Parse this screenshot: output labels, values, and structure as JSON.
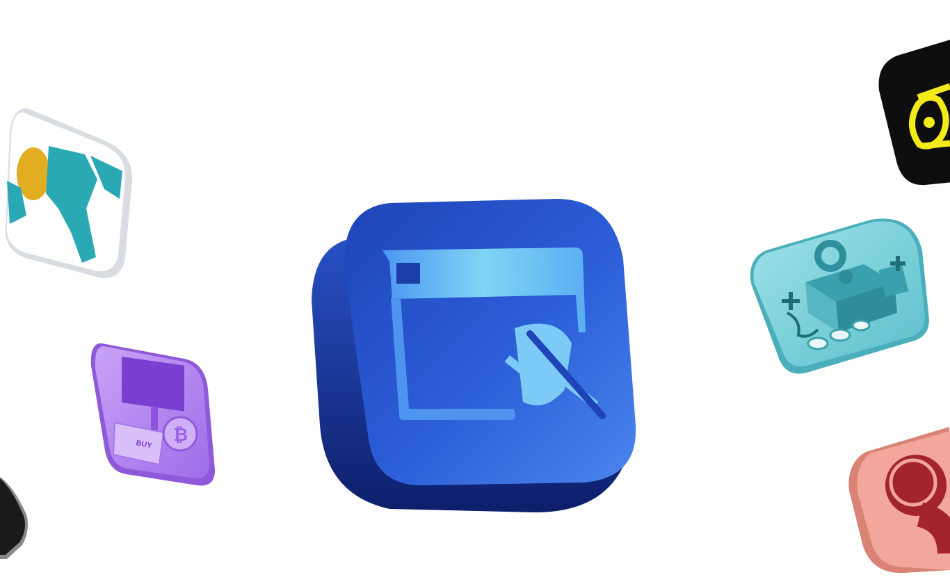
{
  "scene": {
    "background": "#ffffff",
    "tiles": [
      {
        "name": "web-plugin-disconnect",
        "icon": "browser-window-unplugged-icon",
        "color": "#2f5fd8"
      },
      {
        "name": "world-map",
        "icon": "globe-map-icon",
        "color": "#2aa8b3"
      },
      {
        "name": "crypto-buy",
        "icon": "bitcoin-terminal-icon",
        "color": "#b888f0"
      },
      {
        "name": "crypto-network",
        "icon": "blockchain-puzzle-icon",
        "color": "#6fc9d3"
      },
      {
        "name": "announcement",
        "icon": "megaphone-icon",
        "color": "#111111"
      },
      {
        "name": "record",
        "icon": "record-button-icon",
        "color": "#f1a294"
      },
      {
        "name": "dark-partial",
        "icon": "dark-tile-icon",
        "color": "#1a1a1a"
      }
    ]
  },
  "labels": {
    "buy": "BUY"
  }
}
